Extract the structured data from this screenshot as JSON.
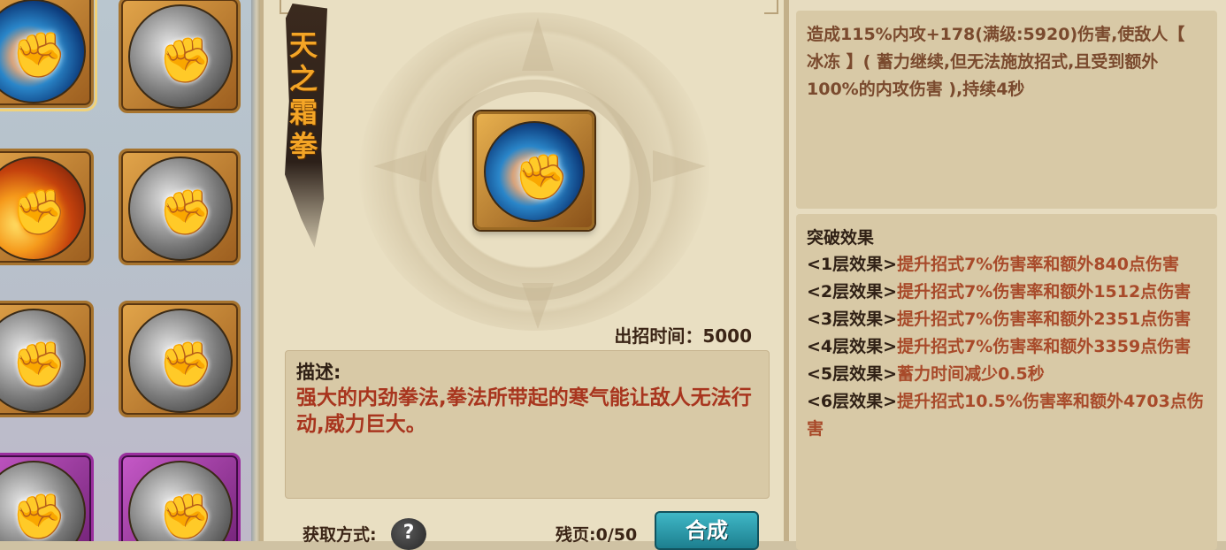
{
  "skill_grid": {
    "slots": [
      {
        "icon": "ice-fist-icon",
        "style": "ice",
        "selected": true
      },
      {
        "icon": "silver-fist-icon",
        "style": "silver",
        "selected": false
      },
      {
        "icon": "fire-fist-icon",
        "style": "fire",
        "selected": false
      },
      {
        "icon": "gray-fist-icon",
        "style": "silver",
        "selected": false
      },
      {
        "icon": "white-fist-icon",
        "style": "silver",
        "selected": false
      },
      {
        "icon": "shadow-fist-icon",
        "style": "silver",
        "selected": false
      },
      {
        "icon": "purple-fist-icon",
        "style": "silver",
        "selected": false
      },
      {
        "icon": "purple-fist-icon-2",
        "style": "silver",
        "selected": false
      }
    ]
  },
  "skill": {
    "name": "天之霜拳",
    "icon": "ice-fist-icon",
    "cast_time_label": "出招时间：5000",
    "description_label": "描述:",
    "description": "强大的内劲拳法,拳法所带起的寒气能让敌人无法行动,威力巨大。"
  },
  "bottom": {
    "obtain_label": "获取方式:",
    "help_glyph": "?",
    "fragments": "残页:0/50",
    "synthesize_label": "合成"
  },
  "effect": {
    "text": "造成115%内攻+178(满级:5920)伤害,使敌人【 冰冻 】( 蓄力继续,但无法施放招式,且受到额外100%的内攻伤害 ),持续4秒"
  },
  "breakthrough": {
    "title": "突破效果",
    "levels": [
      {
        "level": "<1层效果>",
        "desc": "提升招式7%伤害率和额外840点伤害"
      },
      {
        "level": "<2层效果>",
        "desc": "提升招式7%伤害率和额外1512点伤害"
      },
      {
        "level": "<3层效果>",
        "desc": "提升招式7%伤害率和额外2351点伤害"
      },
      {
        "level": "<4层效果>",
        "desc": "提升招式7%伤害率和额外3359点伤害"
      },
      {
        "level": "<5层效果>",
        "desc": "蓄力时间减少0.5秒"
      },
      {
        "level": "<6层效果>",
        "desc": "提升招式10.5%伤害率和额外4703点伤害"
      }
    ]
  },
  "colors": {
    "accent_orange": "#f4a526",
    "red_text": "#a8351e",
    "teal_button": "#2a9aab"
  }
}
